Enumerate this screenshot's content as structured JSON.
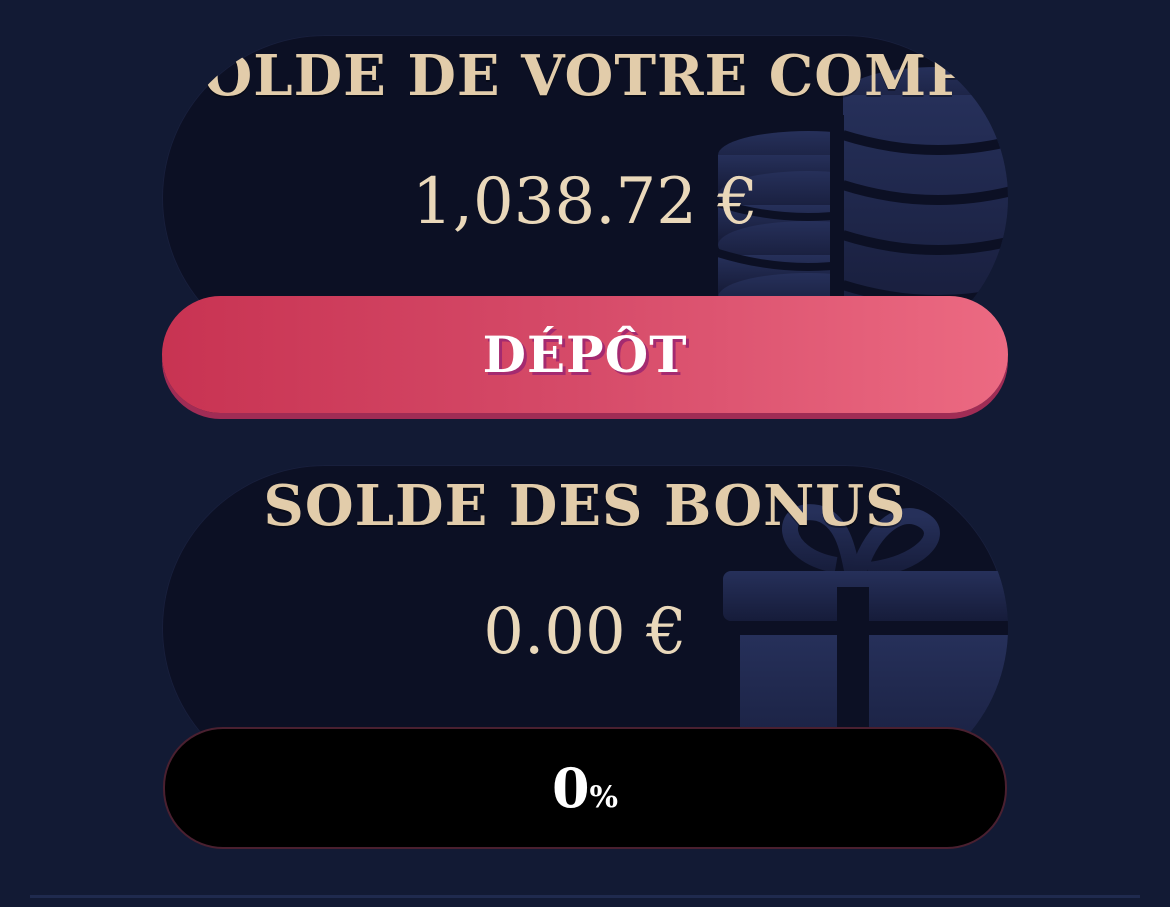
{
  "account": {
    "title": "SOLDE DE VOTRE COMPTE",
    "amount": "1,038.72 €"
  },
  "deposit": {
    "label": "DÉPÔT"
  },
  "bonus": {
    "title": "SOLDE DES BONUS",
    "amount": "0.00 €",
    "progress_value": "0",
    "progress_unit": "%",
    "progress_fraction": 0
  },
  "colors": {
    "background": "#121a34",
    "card": "#0c1024",
    "gold_text": "#e2ccaa",
    "deposit_start": "#c83352",
    "deposit_end": "#ec6a82"
  },
  "icons": {
    "account_decoration": "coins-stack-icon",
    "bonus_decoration": "gift-icon"
  }
}
